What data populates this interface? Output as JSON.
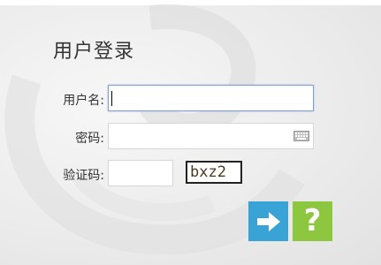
{
  "login": {
    "title": "用户登录",
    "username_label": "用户名:",
    "username_value": "",
    "password_label": "密码:",
    "password_value": "",
    "captcha_label": "验证码:",
    "captcha_value": "",
    "captcha_image_text": "bxz2"
  },
  "buttons": {
    "submit_icon": "arrow-right-icon",
    "help_icon": "question-mark-icon",
    "help_symbol": "?"
  },
  "colors": {
    "submit": "#3aa3d6",
    "help": "#8dc63f",
    "focus_border": "#7f9fdc"
  }
}
